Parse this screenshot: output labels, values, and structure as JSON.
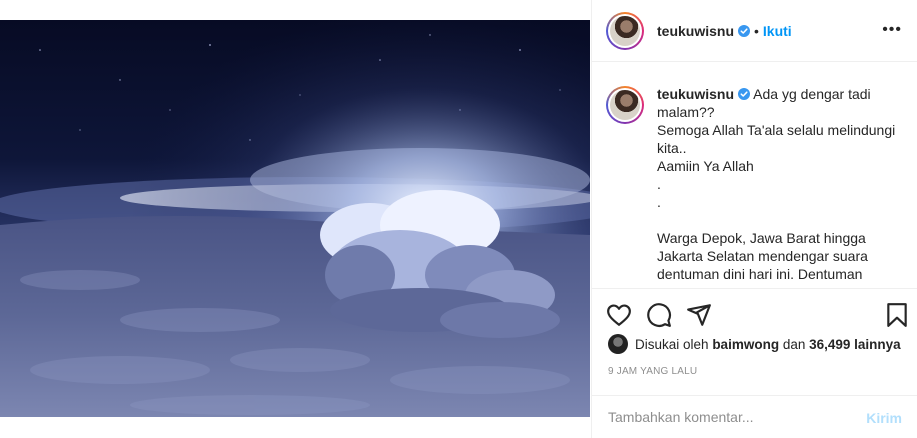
{
  "colors": {
    "accent": "#0095f6",
    "post_disabled": "#b2dffc",
    "muted": "#8e8e8e",
    "text": "#262626",
    "border": "#efefef"
  },
  "media": {
    "icon": "photo-storm-cloud-night"
  },
  "header": {
    "username": "teukuwisnu",
    "separator": "•",
    "follow_label": "Ikuti",
    "more_label": "•••"
  },
  "caption": {
    "username": "teukuwisnu",
    "lines": [
      "Ada yg dengar tadi",
      "malam??",
      "Semoga Allah Ta'ala selalu melindungi",
      "kita..",
      "Aamiin Ya Allah",
      ".",
      ".",
      " ",
      "Warga Depok, Jawa Barat hingga",
      "Jakarta Selatan mendengar suara",
      "dentuman dini hari ini. Dentuman"
    ]
  },
  "actions": {
    "icons": [
      "heart-icon",
      "comment-icon",
      "share-icon",
      "bookmark-icon"
    ]
  },
  "likes": {
    "prefix": "Disukai oleh",
    "user": "baimwong",
    "connector": "dan",
    "count": "36,499 lainnya"
  },
  "timestamp": "9 JAM YANG LALU",
  "comment": {
    "placeholder": "Tambahkan komentar...",
    "post_label": "Kirim"
  }
}
